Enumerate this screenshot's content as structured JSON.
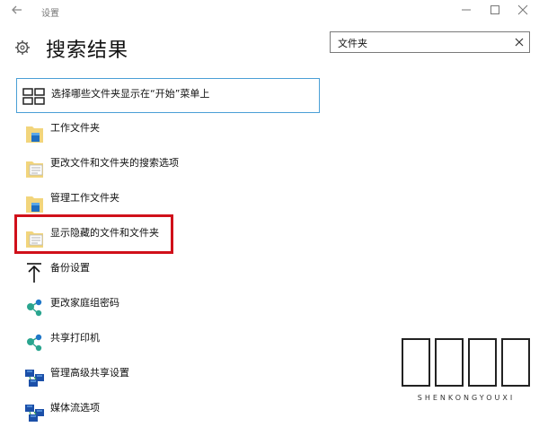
{
  "window": {
    "title": "设置",
    "back_icon": "back-arrow-icon",
    "min_icon": "minimize-icon",
    "max_icon": "maximize-icon",
    "close_icon": "close-icon"
  },
  "header": {
    "settings_icon": "gear-icon",
    "title": "搜索结果"
  },
  "search": {
    "value": "文件夹",
    "clear_icon": "clear-icon"
  },
  "results": [
    {
      "label": "选择哪些文件夹显示在“开始”菜单上",
      "icon": "start-folders-icon"
    },
    {
      "label": "工作文件夹",
      "icon": "work-folder-icon"
    },
    {
      "label": "更改文件和文件夹的搜索选项",
      "icon": "folder-options-icon"
    },
    {
      "label": "管理工作文件夹",
      "icon": "work-folder-icon"
    },
    {
      "label": "显示隐藏的文件和文件夹",
      "icon": "folder-options-icon"
    },
    {
      "label": "备份设置",
      "icon": "backup-arrow-icon"
    },
    {
      "label": "更改家庭组密码",
      "icon": "homegroup-icon"
    },
    {
      "label": "共享打印机",
      "icon": "homegroup-icon"
    },
    {
      "label": "管理高级共享设置",
      "icon": "network-icon"
    },
    {
      "label": "媒体流选项",
      "icon": "network-icon"
    }
  ],
  "highlighted_result": "显示隐藏的文件和文件夹",
  "watermark": {
    "chars": [
      "深",
      "空",
      "遊",
      "戲"
    ],
    "subtitle": "SHENKONGYOUXI"
  },
  "colors": {
    "highlight_border": "#d0101a",
    "focus_border": "#4a9fd6",
    "folder": "#f2d57c",
    "homegroup": "#2aa58f"
  }
}
